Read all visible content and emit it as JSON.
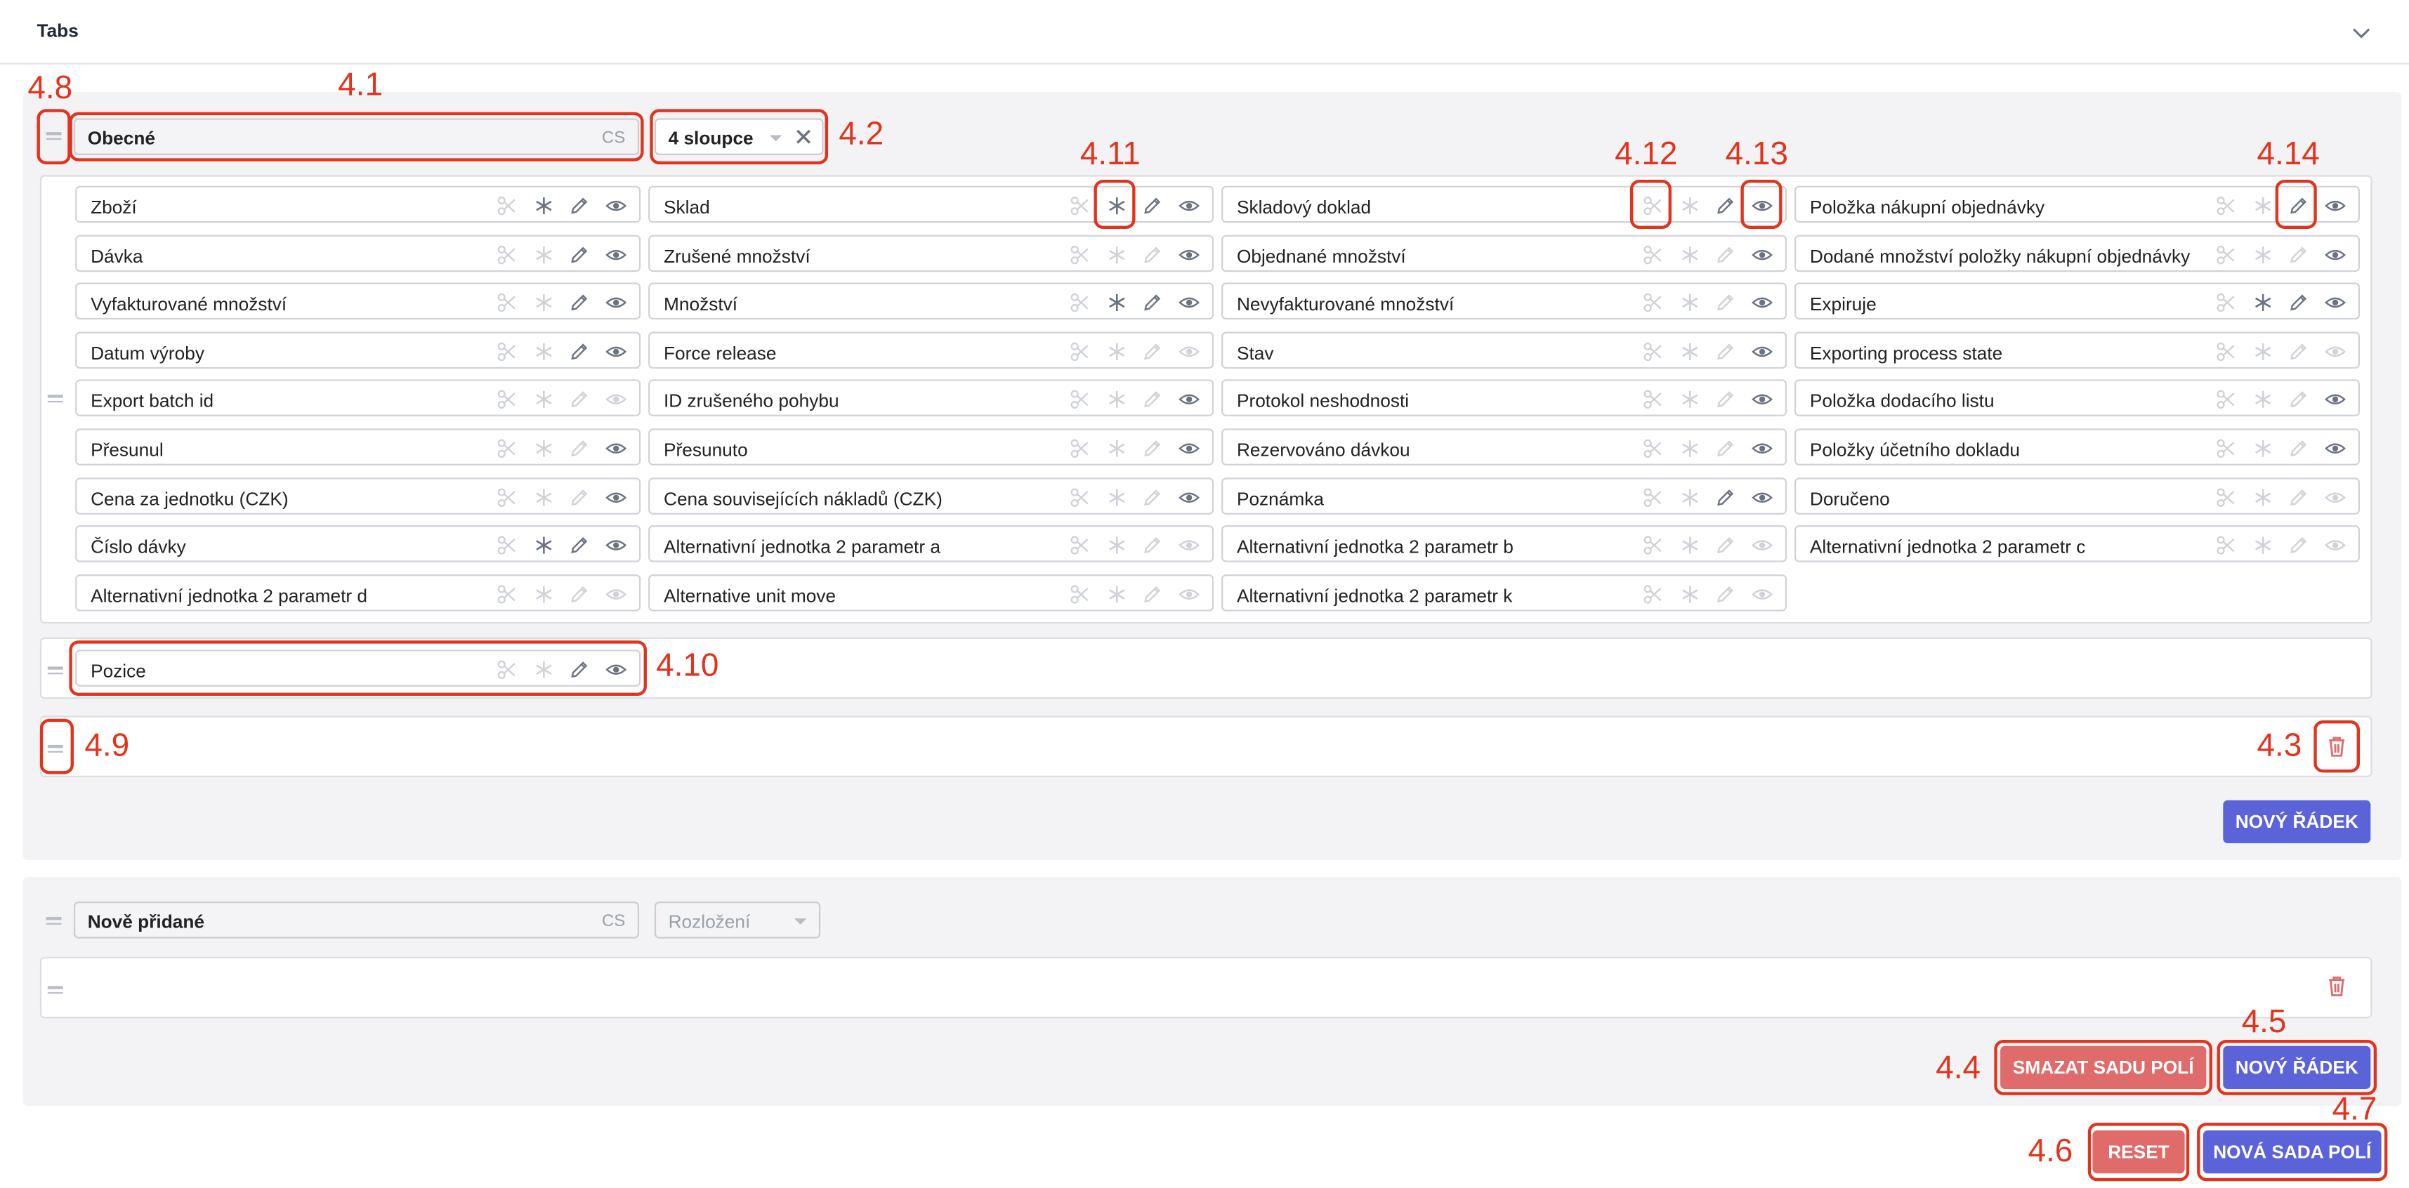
{
  "header": {
    "title": "Tabs"
  },
  "group1": {
    "name": "Obecné",
    "lang": "CS",
    "layout": "4 sloupce",
    "columns": [
      [
        {
          "label": "Zboží",
          "s": [
            0,
            1,
            1,
            1
          ]
        },
        {
          "label": "Dávka",
          "s": [
            0,
            0,
            1,
            1
          ]
        },
        {
          "label": "Vyfakturované množství",
          "s": [
            0,
            0,
            1,
            1
          ]
        },
        {
          "label": "Datum výroby",
          "s": [
            0,
            0,
            1,
            1
          ]
        },
        {
          "label": "Export batch id",
          "s": [
            0,
            0,
            0,
            0
          ]
        },
        {
          "label": "Přesunul",
          "s": [
            0,
            0,
            0,
            1
          ]
        },
        {
          "label": "Cena za jednotku (CZK)",
          "s": [
            0,
            0,
            0,
            1
          ]
        },
        {
          "label": "Číslo dávky",
          "s": [
            0,
            1,
            1,
            1
          ]
        },
        {
          "label": "Alternativní jednotka 2 parametr d",
          "s": [
            0,
            0,
            0,
            0
          ]
        }
      ],
      [
        {
          "label": "Sklad",
          "s": [
            0,
            1,
            1,
            1
          ]
        },
        {
          "label": "Zrušené množství",
          "s": [
            0,
            0,
            0,
            1
          ]
        },
        {
          "label": "Množství",
          "s": [
            0,
            1,
            1,
            1
          ]
        },
        {
          "label": "Force release",
          "s": [
            0,
            0,
            0,
            0
          ]
        },
        {
          "label": "ID zrušeného pohybu",
          "s": [
            0,
            0,
            0,
            1
          ]
        },
        {
          "label": "Přesunuto",
          "s": [
            0,
            0,
            0,
            1
          ]
        },
        {
          "label": "Cena souvisejících nákladů (CZK)",
          "s": [
            0,
            0,
            0,
            1
          ]
        },
        {
          "label": "Alternativní jednotka 2 parametr a",
          "s": [
            0,
            0,
            0,
            0
          ]
        },
        {
          "label": "Alternative unit move",
          "s": [
            0,
            0,
            0,
            0
          ]
        }
      ],
      [
        {
          "label": "Skladový doklad",
          "s": [
            0,
            0,
            1,
            1
          ]
        },
        {
          "label": "Objednané množství",
          "s": [
            0,
            0,
            0,
            1
          ]
        },
        {
          "label": "Nevyfakturované množství",
          "s": [
            0,
            0,
            0,
            1
          ]
        },
        {
          "label": "Stav",
          "s": [
            0,
            0,
            0,
            1
          ]
        },
        {
          "label": "Protokol neshodnosti",
          "s": [
            0,
            0,
            0,
            1
          ]
        },
        {
          "label": "Rezervováno dávkou",
          "s": [
            0,
            0,
            0,
            1
          ]
        },
        {
          "label": "Poznámka",
          "s": [
            0,
            0,
            1,
            1
          ]
        },
        {
          "label": "Alternativní jednotka 2 parametr b",
          "s": [
            0,
            0,
            0,
            0
          ]
        },
        {
          "label": "Alternativní jednotka 2 parametr k",
          "s": [
            0,
            0,
            0,
            0
          ]
        }
      ],
      [
        {
          "label": "Položka nákupní objednávky",
          "s": [
            0,
            0,
            1,
            1
          ]
        },
        {
          "label": "Dodané množství položky nákupní objednávky",
          "s": [
            0,
            0,
            0,
            1
          ]
        },
        {
          "label": "Expiruje",
          "s": [
            0,
            1,
            1,
            1
          ]
        },
        {
          "label": "Exporting process state",
          "s": [
            0,
            0,
            0,
            0
          ]
        },
        {
          "label": "Položka dodacího listu",
          "s": [
            0,
            0,
            0,
            1
          ]
        },
        {
          "label": "Položky účetního dokladu",
          "s": [
            0,
            0,
            0,
            1
          ]
        },
        {
          "label": "Doručeno",
          "s": [
            0,
            0,
            0,
            0
          ]
        },
        {
          "label": "Alternativní jednotka 2 parametr c",
          "s": [
            0,
            0,
            0,
            0
          ]
        }
      ]
    ],
    "row2_field": "Pozice",
    "new_row_label": "NOVÝ ŘÁDEK"
  },
  "group2": {
    "name": "Nově přidané",
    "lang": "CS",
    "layout_placeholder": "Rozložení",
    "delete_set_label": "SMAZAT SADU POLÍ",
    "new_row_label": "NOVÝ ŘÁDEK"
  },
  "footer": {
    "reset_label": "RESET",
    "new_set_label": "NOVÁ SADA POLÍ"
  },
  "annotations": {
    "a41": "4.1",
    "a42": "4.2",
    "a43": "4.3",
    "a44": "4.4",
    "a45": "4.5",
    "a46": "4.6",
    "a47": "4.7",
    "a48": "4.8",
    "a49": "4.9",
    "a410": "4.10",
    "a411": "4.11",
    "a412": "4.12",
    "a413": "4.13",
    "a414": "4.14"
  },
  "colors": {
    "accent": "#5b63d9",
    "danger": "#e06b6b",
    "annotation": "#e2341d",
    "icon_active": "#6b7280",
    "icon_inactive": "#cfd2d8"
  },
  "icons": [
    "scissors-icon",
    "asterisk-icon",
    "pencil-icon",
    "eye-icon",
    "drag-handle-icon",
    "trash-icon",
    "chevron-down-icon",
    "clear-icon"
  ]
}
